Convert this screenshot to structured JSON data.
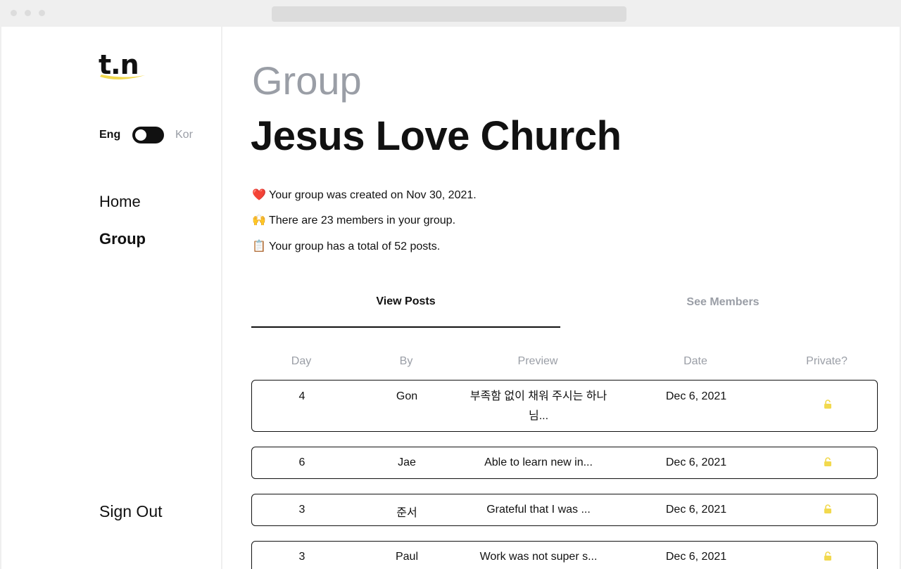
{
  "brand": {
    "logo": "t.n",
    "accent": "#f2d94e"
  },
  "language": {
    "left": "Eng",
    "right": "Kor"
  },
  "nav": {
    "home": "Home",
    "group": "Group",
    "sign_out": "Sign Out"
  },
  "header": {
    "eyebrow": "Group",
    "title": "Jesus Love Church"
  },
  "info": [
    {
      "icon": "heart-icon",
      "emoji": "❤️",
      "text": "Your group was created on Nov 30, 2021."
    },
    {
      "icon": "raised-hands-icon",
      "emoji": "🙌",
      "text": "There are 23 members in your group."
    },
    {
      "icon": "clipboard-icon",
      "emoji": "📋",
      "text": "Your group has a total of 52 posts."
    }
  ],
  "tabs": {
    "posts": "View Posts",
    "members": "See Members"
  },
  "table": {
    "columns": [
      "Day",
      "By",
      "Preview",
      "Date",
      "Private?"
    ],
    "rows": [
      {
        "day": "4",
        "by": "Gon",
        "preview_line1": "부족함 없이 채워 주시는 하나",
        "preview_line2": "님...",
        "date": "Dec 6, 2021",
        "private_icon": "unlocked-icon"
      },
      {
        "day": "6",
        "by": "Jae",
        "preview_line1": "Able to learn new in...",
        "preview_line2": "",
        "date": "Dec 6, 2021",
        "private_icon": "unlocked-icon"
      },
      {
        "day": "3",
        "by": "준서",
        "preview_line1": "Grateful that I was ...",
        "preview_line2": "",
        "date": "Dec 6, 2021",
        "private_icon": "unlocked-icon"
      },
      {
        "day": "3",
        "by": "Paul",
        "preview_line1": "Work was not super s...",
        "preview_line2": "",
        "date": "Dec 6, 2021",
        "private_icon": "unlocked-icon"
      }
    ]
  }
}
